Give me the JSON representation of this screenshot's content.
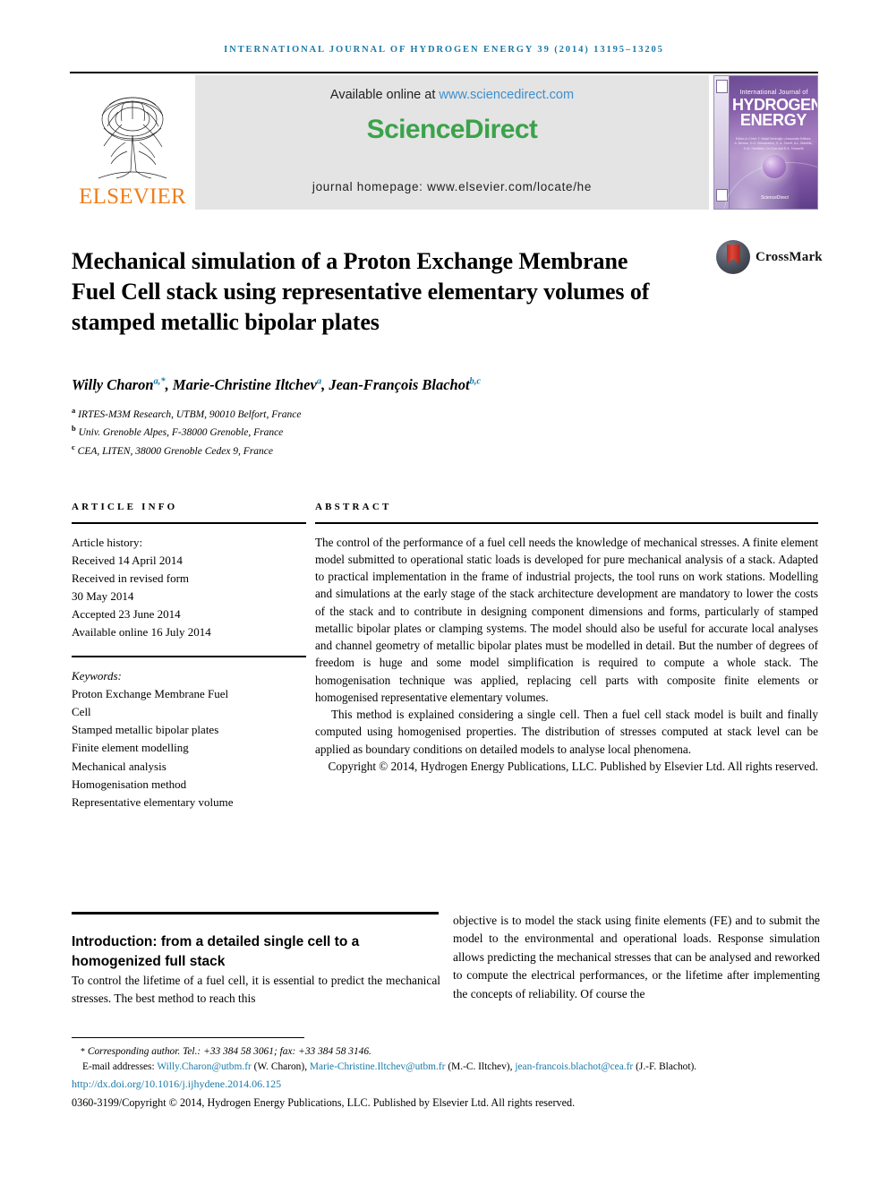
{
  "running_head": "International Journal of Hydrogen Energy 39 (2014) 13195–13205",
  "masthead": {
    "publisher_name": "ELSEVIER",
    "available_prefix": "Available online at ",
    "available_url": "www.sciencedirect.com",
    "sciencedirect_logo": "ScienceDirect",
    "homepage_line": "journal homepage: www.elsevier.com/locate/he",
    "cover": {
      "superline": "International Journal of",
      "title_line1": "HYDROGEN",
      "title_line2": "ENERGY",
      "editors": "Editor-in-Chief: T. Nejat Veziroğlu | Associate Editors: A. Bezian, D.G. Bessarabov, S. A. Sherif, A.L. Mantilla, D.W. Sheffield, Lin Guo and E.A. Ticianelli",
      "footer_mark": "ScienceDirect"
    },
    "colors": {
      "link": "#3b8fd0",
      "sciencedirect_green": "#3aa34a",
      "elsevier_orange": "#ef7d1a",
      "banner_bg": "#e4e4e4"
    }
  },
  "article": {
    "title": "Mechanical simulation of a Proton Exchange Membrane Fuel Cell stack using representative elementary volumes of stamped metallic bipolar plates",
    "crossmark_label": "CrossMark",
    "authors": [
      {
        "name": "Willy Charon",
        "marks": "a,*"
      },
      {
        "name": "Marie-Christine Iltchev",
        "marks": "a"
      },
      {
        "name": "Jean-François Blachot",
        "marks": "b,c"
      }
    ],
    "affiliations": [
      {
        "mark": "a",
        "text": "IRTES-M3M Research, UTBM, 90010 Belfort, France"
      },
      {
        "mark": "b",
        "text": "Univ. Grenoble Alpes, F-38000 Grenoble, France"
      },
      {
        "mark": "c",
        "text": "CEA, LITEN, 38000 Grenoble Cedex 9, France"
      }
    ]
  },
  "article_info": {
    "heading": "Article info",
    "history_label": "Article history:",
    "history": [
      "Received 14 April 2014",
      "Received in revised form",
      "30 May 2014",
      "Accepted 23 June 2014",
      "Available online 16 July 2014"
    ],
    "keywords_label": "Keywords:",
    "keywords": [
      "Proton Exchange Membrane Fuel",
      "Cell",
      "Stamped metallic bipolar plates",
      "Finite element modelling",
      "Mechanical analysis",
      "Homogenisation method",
      "Representative elementary volume"
    ]
  },
  "abstract": {
    "heading": "Abstract",
    "paragraph_1": "The control of the performance of a fuel cell needs the knowledge of mechanical stresses. A finite element model submitted to operational static loads is developed for pure mechanical analysis of a stack. Adapted to practical implementation in the frame of industrial projects, the tool runs on work stations. Modelling and simulations at the early stage of the stack architecture development are mandatory to lower the costs of the stack and to contribute in designing component dimensions and forms, particularly of stamped metallic bipolar plates or clamping systems. The model should also be useful for accurate local analyses and channel geometry of metallic bipolar plates must be modelled in detail. But the number of degrees of freedom is huge and some model simplification is required to compute a whole stack. The homogenisation technique was applied, replacing cell parts with composite finite elements or homogenised representative elementary volumes.",
    "paragraph_2": "This method is explained considering a single cell. Then a fuel cell stack model is built and finally computed using homogenised properties. The distribution of stresses computed at stack level can be applied as boundary conditions on detailed models to analyse local phenomena.",
    "copyright": "Copyright © 2014, Hydrogen Energy Publications, LLC. Published by Elsevier Ltd. All rights reserved."
  },
  "section": {
    "heading": "Introduction: from a detailed single cell to a homogenized full stack",
    "column_left": "To control the lifetime of a fuel cell, it is essential to predict the mechanical stresses. The best method to reach this",
    "column_right": "objective is to model the stack using finite elements (FE) and to submit the model to the environmental and operational loads. Response simulation allows predicting the mechanical stresses that can be analysed and reworked to compute the electrical performances, or the lifetime after implementing the concepts of reliability. Of course the"
  },
  "footer": {
    "corresponding_star": "*",
    "corresponding_text": "Corresponding author. Tel.: +33 384 58 3061; fax: +33 384 58 3146.",
    "emails_label": "E-mail addresses:",
    "emails": [
      {
        "address": "Willy.Charon@utbm.fr",
        "owner": "(W. Charon)"
      },
      {
        "address": "Marie-Christine.Iltchev@utbm.fr",
        "owner": "(M.-C. Iltchev)"
      },
      {
        "address": "jean-francois.blachot@cea.fr",
        "owner": "(J.-F. Blachot)."
      }
    ],
    "doi": "http://dx.doi.org/10.1016/j.ijhydene.2014.06.125",
    "issn_line": "0360-3199/Copyright © 2014, Hydrogen Energy Publications, LLC. Published by Elsevier Ltd. All rights reserved."
  }
}
